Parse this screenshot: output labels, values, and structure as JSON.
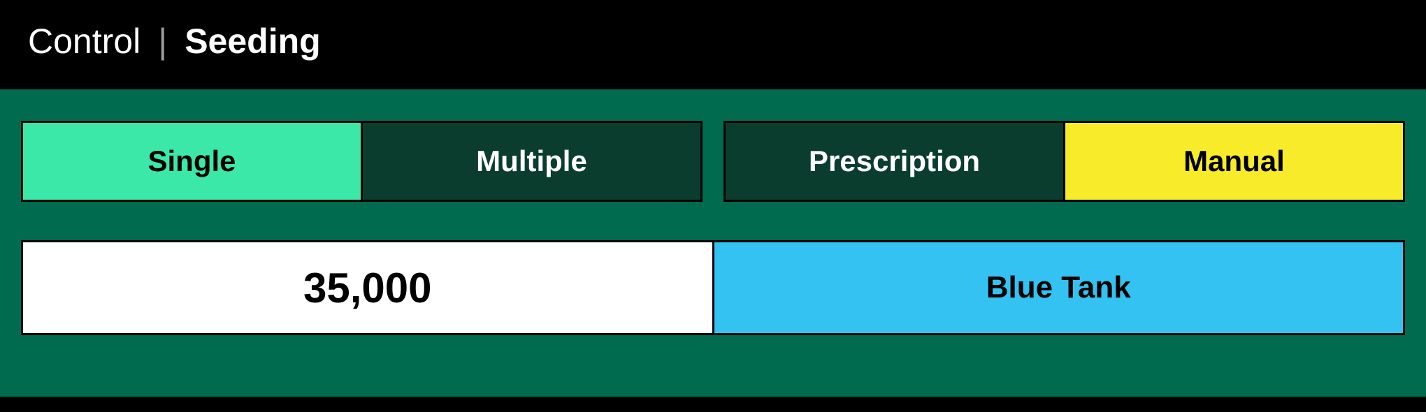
{
  "breadcrumb": {
    "parent": "Control",
    "current": "Seeding"
  },
  "toggles": {
    "group1": {
      "option1": "Single",
      "option2": "Multiple"
    },
    "group2": {
      "option1": "Prescription",
      "option2": "Manual"
    }
  },
  "values": {
    "rate": "35,000",
    "tank": "Blue Tank"
  }
}
